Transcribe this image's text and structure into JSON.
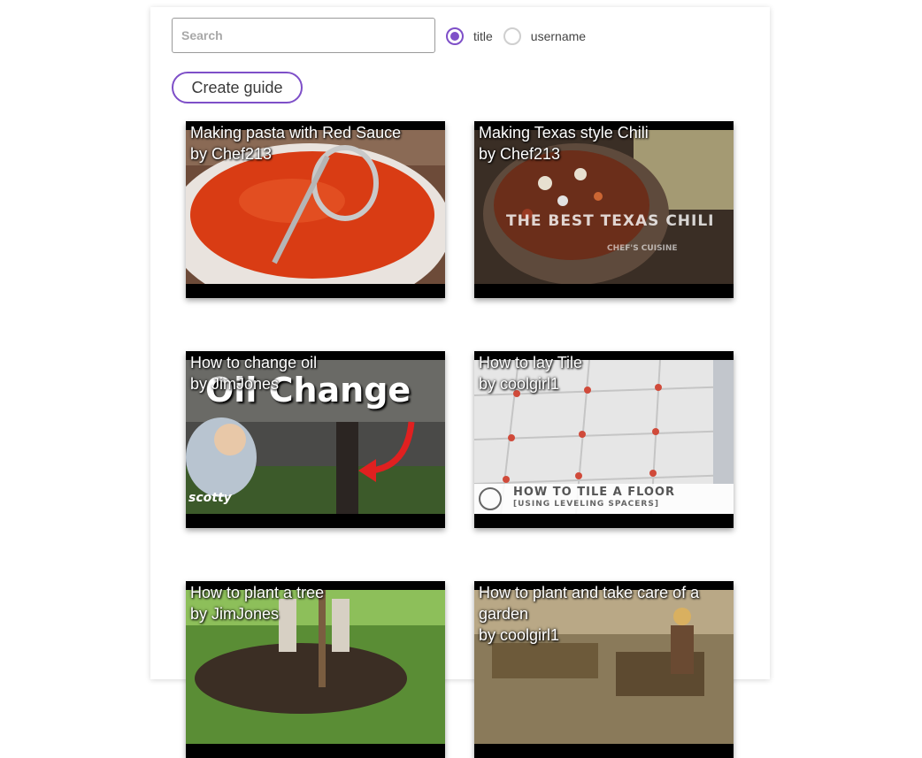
{
  "search": {
    "placeholder": "Search",
    "value": ""
  },
  "filter": {
    "options": [
      {
        "label": "title",
        "checked": true
      },
      {
        "label": "username",
        "checked": false
      }
    ]
  },
  "create_button_label": "Create guide",
  "accent_color": "#7e4fc8",
  "guides": [
    {
      "title": "Making pasta with Red Sauce",
      "author": "by Chef213"
    },
    {
      "title": "Making Texas style Chili",
      "author": "by Chef213",
      "overlay": {
        "main": "THE BEST TEXAS CHILI",
        "sub": "CHEF'S CUISINE"
      }
    },
    {
      "title": "How to change oil",
      "author": "by JimJones",
      "overlay": {
        "main": "Oil Change",
        "sub": "scotty"
      }
    },
    {
      "title": "How to lay Tile",
      "author": "by coolgirl1",
      "overlay": {
        "main": "HOW TO TILE A FLOOR",
        "sub": "[USING LEVELING SPACERS]"
      }
    },
    {
      "title": "How to plant a tree",
      "author": "by JimJones"
    },
    {
      "title": "How to plant and take care of a garden",
      "author": "by coolgirl1"
    }
  ]
}
